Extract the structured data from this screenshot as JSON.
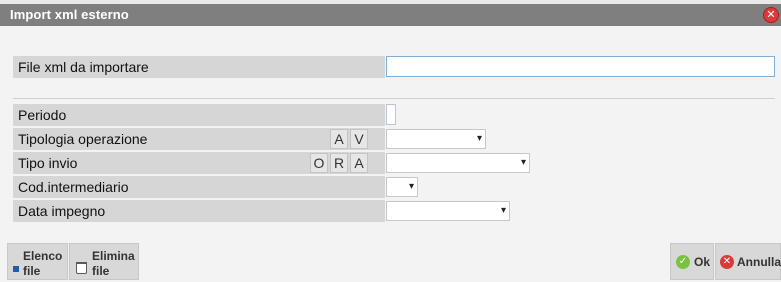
{
  "window": {
    "title": "Import xml esterno",
    "close_glyph": "✕"
  },
  "file_section": {
    "label": "File xml da importare",
    "value": ""
  },
  "fields": {
    "periodo": {
      "label": "Periodo",
      "value": ""
    },
    "tipologia_operazione": {
      "label": "Tipologia operazione",
      "options": [
        "A",
        "V"
      ],
      "value": ""
    },
    "tipo_invio": {
      "label": "Tipo invio",
      "options": [
        "O",
        "R",
        "A"
      ],
      "value": ""
    },
    "cod_intermediario": {
      "label": "Cod.intermediario",
      "value": ""
    },
    "data_impegno": {
      "label": "Data impegno",
      "value": ""
    }
  },
  "footer": {
    "elenco_file": {
      "line1": "Elenco",
      "line2": "file",
      "icon": "blue-square-icon"
    },
    "elimina_file": {
      "line1": "Elimina",
      "line2": "file",
      "icon": "trash-icon"
    },
    "ok": {
      "label": "Ok",
      "icon": "check-icon"
    },
    "annulla": {
      "label": "Annulla",
      "icon": "cancel-icon"
    }
  },
  "colors": {
    "titlebar": "#7f7f7f",
    "label_bg": "#d6d6d6",
    "body_bg": "#f3f3f3",
    "ok_green": "#7cc242",
    "cancel_red": "#d93a3a"
  },
  "dropdown_glyph": "▾",
  "check_glyph": "✓",
  "cancel_glyph": "✕"
}
